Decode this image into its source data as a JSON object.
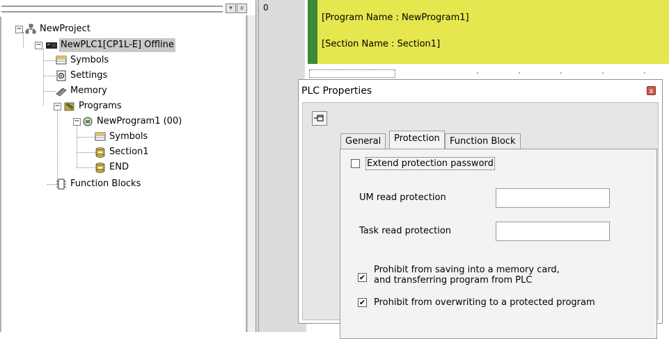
{
  "tree": {
    "items": [
      {
        "label": "NewProject"
      },
      {
        "label": "NewPLC1[CP1L-E] Offline"
      },
      {
        "label": "Symbols"
      },
      {
        "label": "Settings"
      },
      {
        "label": "Memory"
      },
      {
        "label": "Programs"
      },
      {
        "label": "NewProgram1 (00)"
      },
      {
        "label": "Symbols"
      },
      {
        "label": "Section1"
      },
      {
        "label": "END"
      },
      {
        "label": "Function Blocks"
      }
    ],
    "pane_buttons": {
      "minimize": "▾",
      "close": "x"
    }
  },
  "editor": {
    "row_number": "0",
    "program_name": "[Program Name : NewProgram1]",
    "section_name": "[Section Name : Section1]",
    "colors": {
      "comment_bg": "#e6e64f",
      "rung_bar": "#3a8a3a"
    }
  },
  "dialog": {
    "title": "PLC Properties",
    "close_glyph": "x",
    "pin_glyph": "⊣",
    "tabs": [
      {
        "label": "General",
        "active": false
      },
      {
        "label": "Protection",
        "active": true
      },
      {
        "label": "Function Block",
        "active": false
      }
    ],
    "extend_password": {
      "label": "Extend protection password",
      "checked": false
    },
    "um_read": {
      "label": "UM read protection",
      "value": ""
    },
    "task_read": {
      "label": "Task read protection",
      "value": ""
    },
    "prohibit_saving": {
      "line1": "Prohibit from saving into a memory card,",
      "line2": "and transferring program from PLC",
      "checked": true
    },
    "prohibit_overwrite": {
      "label": "Prohibit from overwriting to a protected program",
      "checked": true
    },
    "check_glyph": "✔"
  }
}
